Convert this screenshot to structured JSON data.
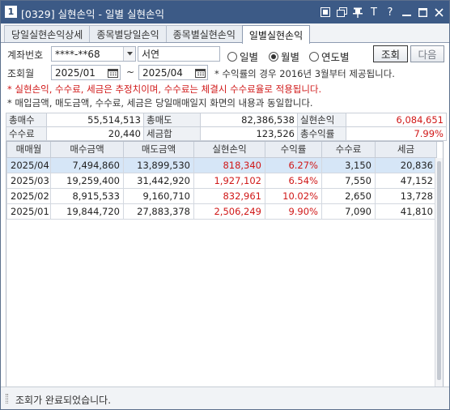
{
  "window": {
    "screen_no": "1",
    "title": "[0329] 실현손익 - 일별 실현손익"
  },
  "title_icons": [
    "link-icon",
    "copy-icon",
    "pin-icon",
    "text-size-icon",
    "help-icon",
    "minimize-icon",
    "maximize-icon",
    "close-icon"
  ],
  "title_glyphs": {
    "text_size": "T",
    "help": "?"
  },
  "tabs": [
    {
      "label": "당일실현손익상세",
      "active": false
    },
    {
      "label": "종목별당일손익",
      "active": false
    },
    {
      "label": "종목별실현손익",
      "active": false
    },
    {
      "label": "일별실현손익",
      "active": true
    }
  ],
  "form": {
    "account_label": "계좌번호",
    "account_value": "****-**68",
    "account_name": "서연",
    "period_type": {
      "options": [
        "일별",
        "월별",
        "연도별"
      ],
      "selected": "월별"
    },
    "query_button": "조회",
    "next_button": "다음",
    "period_label": "조회월",
    "from": "2025/01",
    "tilde": "~",
    "to": "2025/04",
    "note_rate": "* 수익률의 경우 2016년 3월부터 제공됩니다."
  },
  "notes": {
    "red": "* 실현손익, 수수료, 세금은 추정치이며, 수수료는 체결시 수수료율로 적용됩니다.",
    "dark": "* 매입금액, 매도금액, 수수료, 세금은 당일매매일지 화면의 내용과 동일합니다."
  },
  "summary": {
    "rows": [
      [
        {
          "label": "총매수",
          "value": "55,514,513"
        },
        {
          "label": "총매도",
          "value": "82,386,538"
        },
        {
          "label": "실현손익",
          "value": "6,084,651",
          "red": true
        }
      ],
      [
        {
          "label": "수수료",
          "value": "20,440"
        },
        {
          "label": "세금합",
          "value": "123,526"
        },
        {
          "label": "총수익률",
          "value": "7.99%",
          "red": true
        }
      ]
    ]
  },
  "grid": {
    "headers": [
      "매매월",
      "매수금액",
      "매도금액",
      "실현손익",
      "수익률",
      "수수료",
      "세금"
    ],
    "rows": [
      [
        "2025/04",
        "7,494,860",
        "13,899,530",
        "818,340",
        "6.27%",
        "3,150",
        "20,836"
      ],
      [
        "2025/03",
        "19,259,400",
        "31,442,920",
        "1,927,102",
        "6.54%",
        "7,550",
        "47,152"
      ],
      [
        "2025/02",
        "8,915,533",
        "9,160,710",
        "832,961",
        "10.02%",
        "2,650",
        "13,728"
      ],
      [
        "2025/01",
        "19,844,720",
        "27,883,378",
        "2,506,249",
        "9.90%",
        "7,090",
        "41,810"
      ]
    ],
    "selected_row": 0
  },
  "status": {
    "text": "조회가 완료되었습니다."
  },
  "colors": {
    "titlebar": "#3c5a86",
    "profit": "#d01818",
    "selected_row": "#d6e6f7"
  }
}
